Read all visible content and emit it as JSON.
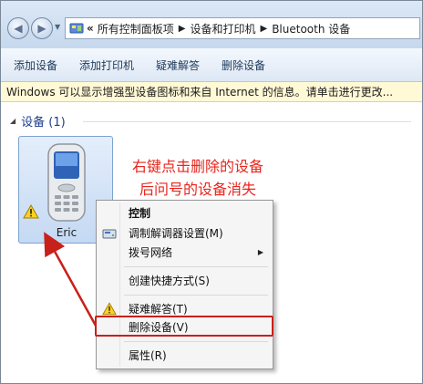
{
  "address": {
    "overflow": "«",
    "crumbs": [
      "所有控制面板项",
      "设备和打印机",
      "Bluetooth 设备"
    ]
  },
  "commands": [
    "添加设备",
    "添加打印机",
    "疑难解答",
    "删除设备"
  ],
  "infobar": {
    "text": "Windows 可以显示增强型设备图标和来自 Internet 的信息。请单击进行更改..."
  },
  "group": {
    "title": "设备 (1)"
  },
  "device": {
    "name": "Eric"
  },
  "annotation": {
    "line1": "右键点击删除的设备",
    "line2": "后问号的设备消失"
  },
  "context_menu": {
    "items": [
      "控制",
      "调制解调器设置(M)",
      "拨号网络",
      "创建快捷方式(S)",
      "疑难解答(T)",
      "删除设备(V)",
      "属性(R)"
    ]
  },
  "colors": {
    "annotation": "#e8261e",
    "highlight": "#c8201a",
    "infobar": "#fff9d6",
    "commandbar": "#dde8f5"
  }
}
